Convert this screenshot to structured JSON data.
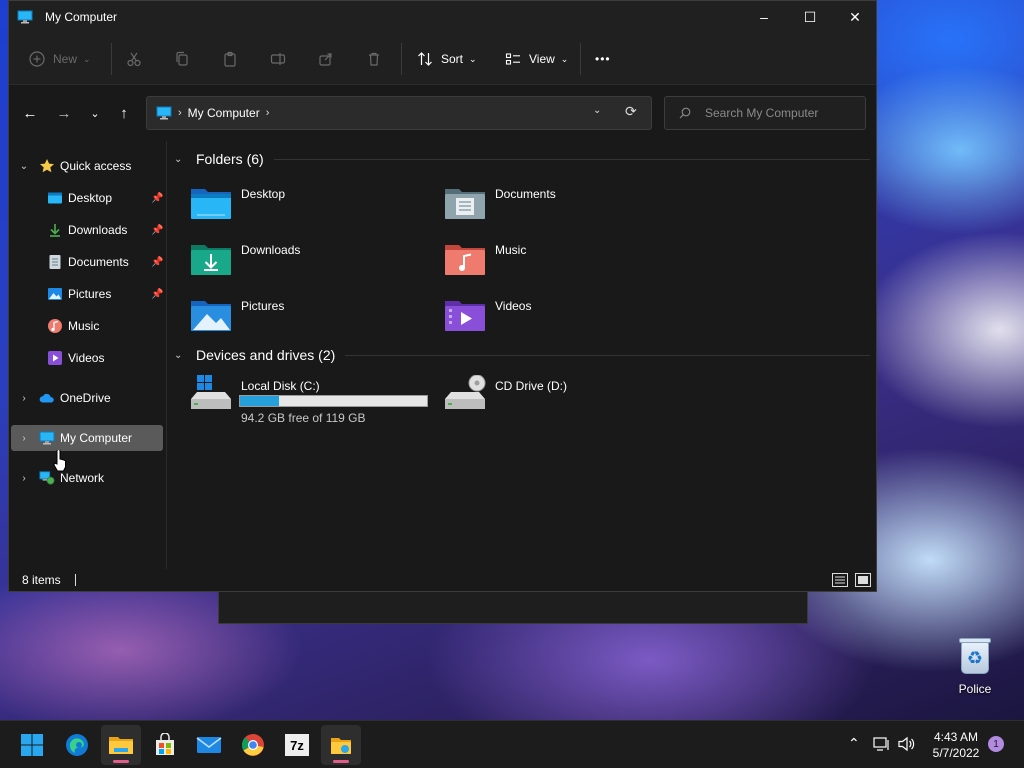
{
  "window": {
    "title": "My Computer",
    "controls": {
      "minimize": "–",
      "maximize": "☐",
      "close": "✕"
    }
  },
  "toolbar": {
    "new_label": "New",
    "sort_label": "Sort",
    "view_label": "View",
    "more_label": "•••"
  },
  "address": {
    "crumb": "My Computer",
    "separator": "›"
  },
  "search": {
    "placeholder": "Search My Computer"
  },
  "sidebar": {
    "items": [
      {
        "label": "Quick access",
        "icon": "star-icon"
      },
      {
        "label": "Desktop",
        "icon": "desktop-folder-icon",
        "pinned": true
      },
      {
        "label": "Downloads",
        "icon": "download-icon",
        "pinned": true
      },
      {
        "label": "Documents",
        "icon": "document-icon",
        "pinned": true
      },
      {
        "label": "Pictures",
        "icon": "pictures-icon",
        "pinned": true
      },
      {
        "label": "Music",
        "icon": "music-icon"
      },
      {
        "label": "Videos",
        "icon": "video-icon"
      },
      {
        "label": "OneDrive",
        "icon": "cloud-icon"
      },
      {
        "label": "My Computer",
        "icon": "computer-icon",
        "selected": true
      },
      {
        "label": "Network",
        "icon": "network-icon"
      }
    ]
  },
  "content": {
    "folders_header": "Folders (6)",
    "folders": [
      {
        "name": "Desktop",
        "icon": "desktop-folder-icon",
        "color": "#1e88e5"
      },
      {
        "name": "Documents",
        "icon": "documents-folder-icon",
        "color": "#6d8bb0"
      },
      {
        "name": "Downloads",
        "icon": "downloads-folder-icon",
        "color": "#1aa88a"
      },
      {
        "name": "Music",
        "icon": "music-folder-icon",
        "color": "#e8665a"
      },
      {
        "name": "Pictures",
        "icon": "pictures-folder-icon",
        "color": "#2a8ee0"
      },
      {
        "name": "Videos",
        "icon": "videos-folder-icon",
        "color": "#8a4fd8"
      }
    ],
    "drives_header": "Devices and drives (2)",
    "drives": [
      {
        "name": "Local Disk (C:)",
        "icon": "hard-drive-icon",
        "free_text": "94.2 GB free of 119 GB",
        "used_fraction": 0.21
      },
      {
        "name": "CD Drive (D:)",
        "icon": "cd-drive-icon"
      }
    ]
  },
  "status": {
    "item_count": "8 items"
  },
  "desktop": {
    "recycle_bin_label": "Police"
  },
  "taskbar": {
    "apps": [
      "windows-start-icon",
      "edge-icon",
      "file-explorer-icon",
      "store-icon",
      "mail-icon",
      "chrome-icon",
      "7zip-icon",
      "explorer-pinned-icon"
    ],
    "sevenzip_label": "7z",
    "time": "4:43 AM",
    "date": "5/7/2022",
    "notification_count": "1"
  },
  "colors": {
    "accent": "#26a0da",
    "window_bg": "#191919",
    "selected_bg": "#5a5a5a",
    "taskbar_bg": "#1c1c1c"
  }
}
